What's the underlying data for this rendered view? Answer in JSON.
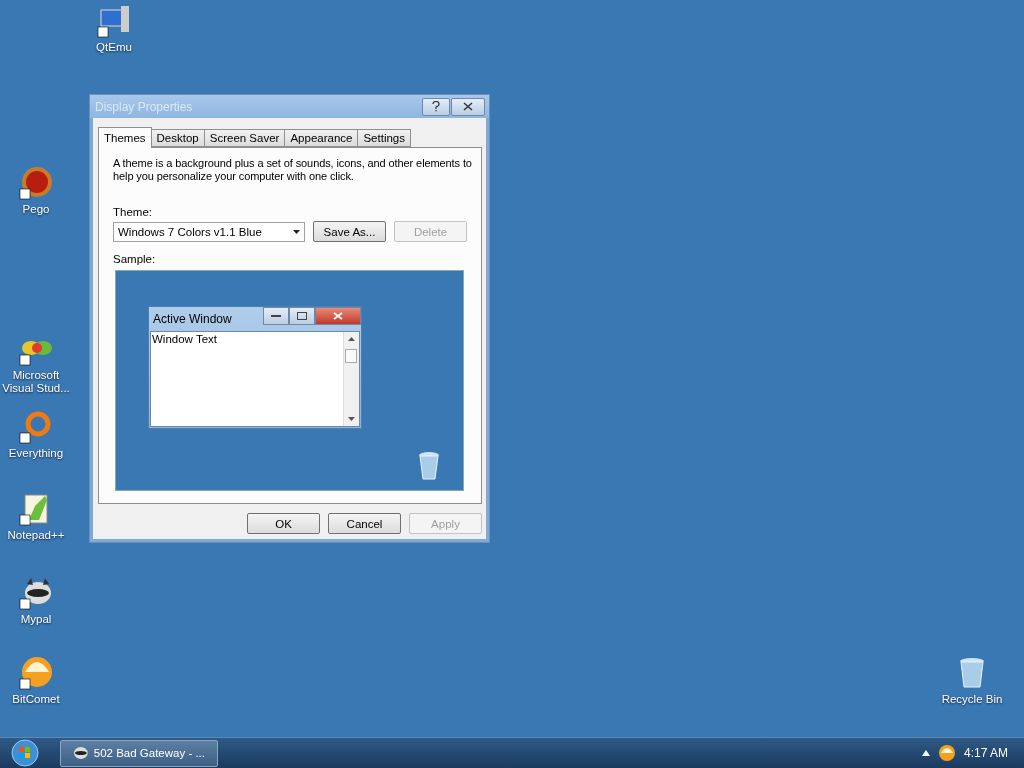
{
  "desktop": {
    "icons": [
      {
        "label": "QtEmu",
        "kind": "monitor"
      },
      {
        "label": "Pego",
        "kind": "ball"
      },
      {
        "label": "Microsoft Visual Stud...",
        "kind": "infinity"
      },
      {
        "label": "Everything",
        "kind": "ring"
      },
      {
        "label": "Notepad++",
        "kind": "notepad"
      },
      {
        "label": "Mypal",
        "kind": "raccoon"
      },
      {
        "label": "BitComet",
        "kind": "comet"
      },
      {
        "label": "Recycle Bin",
        "kind": "bin"
      }
    ]
  },
  "dialog": {
    "title": "Display Properties",
    "tabs": [
      {
        "label": "Themes",
        "selected": true
      },
      {
        "label": "Desktop",
        "selected": false
      },
      {
        "label": "Screen Saver",
        "selected": false
      },
      {
        "label": "Appearance",
        "selected": false
      },
      {
        "label": "Settings",
        "selected": false
      }
    ],
    "description": "A theme is a background plus a set of sounds, icons, and other elements to help you personalize your computer with one click.",
    "theme_label": "Theme:",
    "theme_value": "Windows 7 Colors v1.1 Blue",
    "theme_buttons": [
      {
        "label": "Save As...",
        "disabled": false
      },
      {
        "label": "Delete",
        "disabled": true
      }
    ],
    "sample_label": "Sample:",
    "sample": {
      "window_title": "Active Window",
      "window_text": "Window Text"
    },
    "buttons": [
      {
        "label": "OK",
        "disabled": false
      },
      {
        "label": "Cancel",
        "disabled": false
      },
      {
        "label": "Apply",
        "disabled": true
      }
    ]
  },
  "taskbar": {
    "task": {
      "label": "502 Bad Gateway - ..."
    },
    "clock": "4:17 AM"
  }
}
